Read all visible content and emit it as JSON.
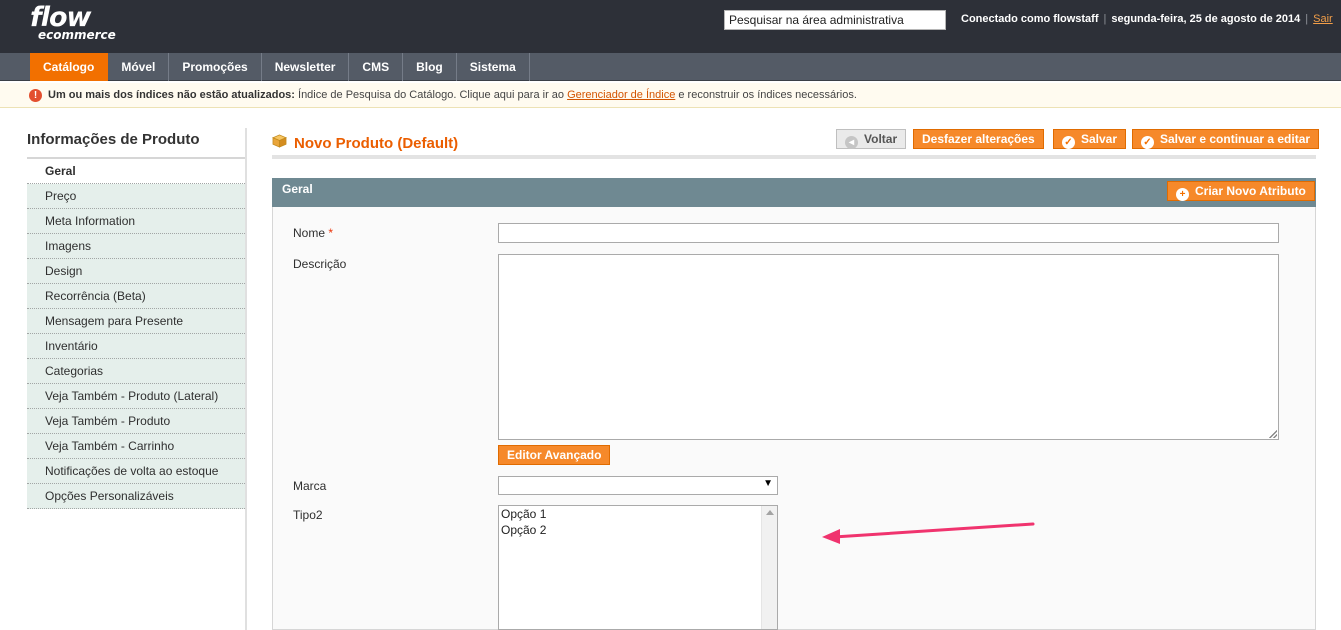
{
  "header": {
    "logo_line1": "flow",
    "logo_line2": "ecommerce",
    "search_value": "Pesquisar na área administrativa",
    "user_text": "Conectado como flowstaff",
    "date_text": "segunda-feira, 25 de agosto de 2014",
    "logout_label": "Sair",
    "separator": "|"
  },
  "nav": {
    "items": [
      {
        "label": "Catálogo"
      },
      {
        "label": "Móvel"
      },
      {
        "label": "Promoções"
      },
      {
        "label": "Newsletter"
      },
      {
        "label": "CMS"
      },
      {
        "label": "Blog"
      },
      {
        "label": "Sistema"
      }
    ]
  },
  "notice": {
    "icon": "!",
    "bold": "Um ou mais dos índices não estão atualizados:",
    "text_before": " Índice de Pesquisa do Catálogo. Clique aqui para ir ao ",
    "link": "Gerenciador de Índice",
    "text_after": " e reconstruir os índices necessários."
  },
  "sidebar": {
    "title": "Informações de Produto",
    "items": [
      {
        "label": "Geral"
      },
      {
        "label": "Preço"
      },
      {
        "label": "Meta Information"
      },
      {
        "label": "Imagens"
      },
      {
        "label": "Design"
      },
      {
        "label": "Recorrência (Beta)"
      },
      {
        "label": "Mensagem para Presente"
      },
      {
        "label": "Inventário"
      },
      {
        "label": "Categorias"
      },
      {
        "label": "Veja Também - Produto (Lateral)"
      },
      {
        "label": "Veja Também - Produto"
      },
      {
        "label": "Veja Também - Carrinho"
      },
      {
        "label": "Notificações de volta ao estoque"
      },
      {
        "label": "Opções Personalizáveis"
      }
    ]
  },
  "page": {
    "title": "Novo Produto (Default)",
    "buttons": {
      "back": "Voltar",
      "reset": "Desfazer alterações",
      "save": "Salvar",
      "save_continue": "Salvar e continuar a editar"
    }
  },
  "panel": {
    "title": "Geral",
    "create_attribute": "Criar Novo Atributo",
    "fields": {
      "name_label": "Nome",
      "required_mark": "*",
      "name_value": "",
      "description_label": "Descrição",
      "description_value": "",
      "editor_button": "Editor Avançado",
      "brand_label": "Marca",
      "brand_value": "",
      "type2_label": "Tipo2",
      "type2_options": [
        "Opção 1",
        "Opção 2"
      ]
    }
  },
  "colors": {
    "accent": "#f27000",
    "header_bg": "#2d3038",
    "nav_bg": "#545b66",
    "panel_head": "#6f8992",
    "annotation_arrow": "#f0336e"
  },
  "icons": {
    "error": "error-icon",
    "box": "box-icon",
    "back": "back-arrow-icon",
    "check": "check-circle-icon",
    "plus": "plus-circle-icon"
  }
}
